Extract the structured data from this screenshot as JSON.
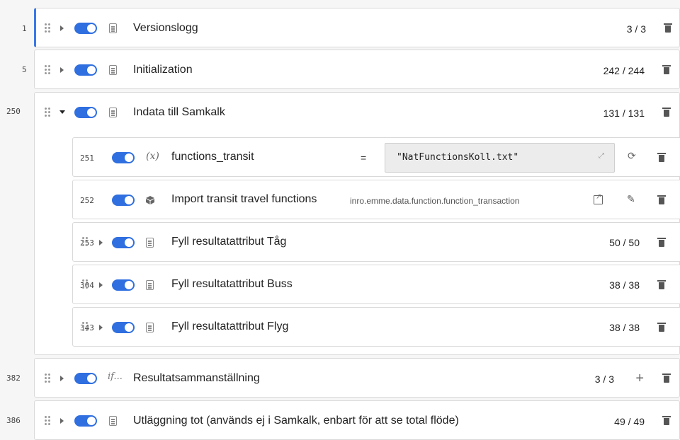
{
  "rows": [
    {
      "line": "1",
      "label": "Versionslogg",
      "count": "3 / 3"
    },
    {
      "line": "5",
      "label": "Initialization",
      "count": "242 / 244"
    },
    {
      "line": "250",
      "label": "Indata till Samkalk",
      "count": "131 / 131"
    },
    {
      "line": "382",
      "label": "Resultatsammanställning",
      "count": "3 / 3"
    },
    {
      "line": "386",
      "label": "Utläggning tot (används ej i Samkalk, enbart för att se total flöde)",
      "count": "49 / 49"
    }
  ],
  "children": [
    {
      "line": "251",
      "label": "functions_transit",
      "var_icon": "(x)",
      "eq": "=",
      "value": "\"NatFunctionsKoll.txt\""
    },
    {
      "line": "252",
      "label": "Import transit travel functions",
      "tool": "inro.emme.data.function.function_transaction"
    },
    {
      "line": "253",
      "label": "Fyll resultatattribut Tåg",
      "count": "50 / 50"
    },
    {
      "line": "304",
      "label": "Fyll resultatattribut Buss",
      "count": "38 / 38"
    },
    {
      "line": "343",
      "label": "Fyll resultatattribut Flyg",
      "count": "38 / 38"
    }
  ],
  "if_icon": "if...",
  "colors": {
    "accent": "#2f6fe0",
    "selected_border": "#3b78e7"
  }
}
